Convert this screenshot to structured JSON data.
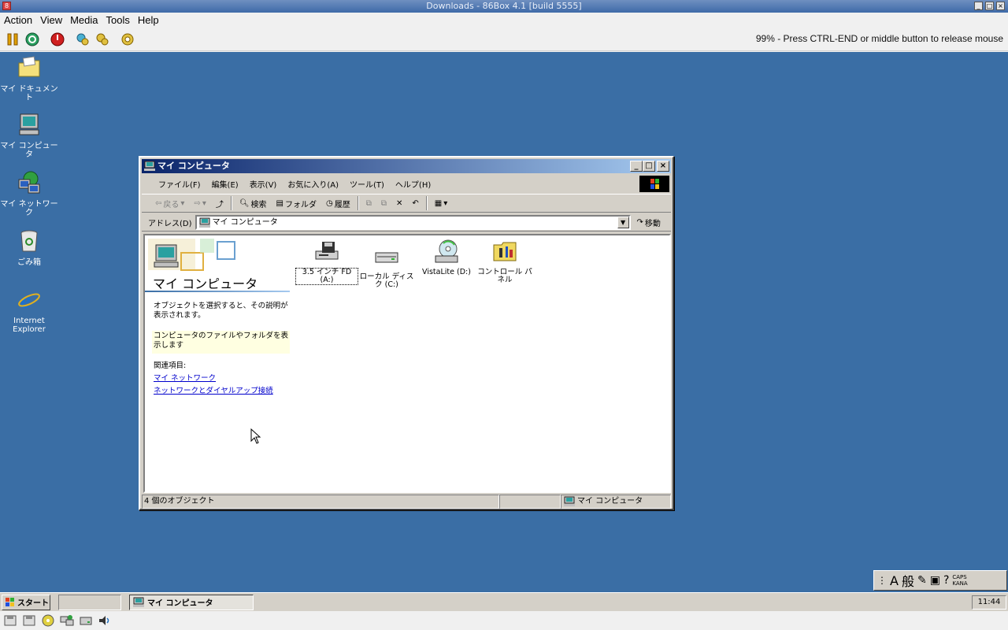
{
  "host": {
    "title": "Downloads - 86Box 4.1 [build 5555]",
    "menu": [
      "Action",
      "View",
      "Media",
      "Tools",
      "Help"
    ],
    "status": "99% - Press CTRL-END or middle button to release mouse",
    "toolbar_icons": [
      "pause-icon",
      "reset-icon",
      "power-icon",
      "settings-icon",
      "settings-icon",
      "settings-icon"
    ]
  },
  "desktop": {
    "icons": [
      {
        "label": "マイ ドキュメント",
        "icon": "folder-icon"
      },
      {
        "label": "マイ コンピュータ",
        "icon": "computer-icon"
      },
      {
        "label": "マイ ネットワーク",
        "icon": "network-icon"
      },
      {
        "label": "ごみ箱",
        "icon": "recycle-bin-icon"
      },
      {
        "label": "Internet Explorer",
        "icon": "internet-explorer-icon"
      }
    ]
  },
  "window": {
    "title": "マイ コンピュータ",
    "menu": [
      "ファイル(F)",
      "編集(E)",
      "表示(V)",
      "お気に入り(A)",
      "ツール(T)",
      "ヘルプ(H)"
    ],
    "toolbar": {
      "back": "戻る",
      "search": "検索",
      "folders": "フォルダ",
      "history": "履歴"
    },
    "address": {
      "label": "アドレス(D)",
      "value": "マイ コンピュータ",
      "go": "移動"
    },
    "sidebar": {
      "title": "マイ コンピュータ",
      "description": "オブジェクトを選択すると、その説明が表示されます。",
      "hint": "コンピュータのファイルやフォルダを表示します",
      "related_label": "関連項目:",
      "links": [
        "マイ ネットワーク",
        "ネットワークとダイヤルアップ接続"
      ]
    },
    "items": [
      {
        "label": "3.5 インチ FD (A:)",
        "icon": "floppy-drive-icon"
      },
      {
        "label": "ローカル ディスク (C:)",
        "icon": "hard-disk-icon"
      },
      {
        "label": "VistaLite (D:)",
        "icon": "cd-drive-icon"
      },
      {
        "label": "コントロール パネル",
        "icon": "control-panel-icon"
      }
    ],
    "status": {
      "count": "4 個のオブジェクト",
      "location": "マイ コンピュータ"
    }
  },
  "taskbar": {
    "start": "スタート",
    "task": "マイ コンピュータ",
    "clock": "11:44"
  },
  "ime": {
    "mode": "般",
    "caps": "CAPS",
    "kana": "KANA"
  }
}
